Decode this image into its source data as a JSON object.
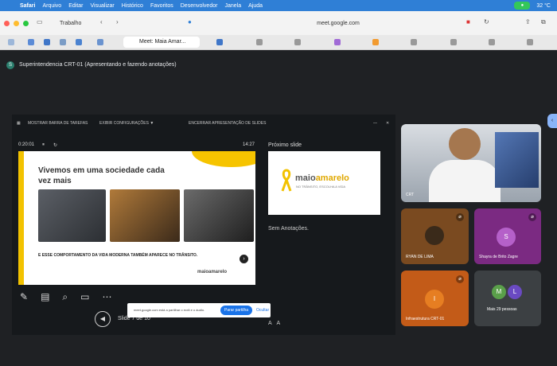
{
  "menubar": {
    "items": [
      "Safari",
      "Arquivo",
      "Editar",
      "Visualizar",
      "Histórico",
      "Favoritos",
      "Desenvolvedor",
      "Janela",
      "Ajuda"
    ],
    "weather": "32 °C"
  },
  "toolbar": {
    "profile": "Trabalho",
    "url": "meet.google.com",
    "active_tab": "Meet: Maia Amar..."
  },
  "meeting": {
    "title": "Superintendencia CRT-01 (Apresentando e fazendo anotações)"
  },
  "presenter": {
    "controls": [
      "MOSTRAR BARRA DE TAREFAS",
      "EXIBIR CONFIGURAÇÕES ▼",
      "ENCERRAR APRESENTAÇÃO DE SLIDES"
    ],
    "elapsed": "0:20:01",
    "clock": "14:27",
    "next_label": "Próximo slide",
    "notes": "Sem Anotações.",
    "slide_counter": "Slide 7 de 10",
    "zoom_labels": [
      "A",
      "A"
    ]
  },
  "slide": {
    "title": "Vivemos em uma sociedade cada vez mais",
    "caption": "E ESSE COMPORTAMENTO DA VIDA MODERNA TAMBÉM APARECE NO TRÂNSITO.",
    "logo": "maioamarelo"
  },
  "next_slide": {
    "logo_a": "maio",
    "logo_b": "amarelo",
    "sub": "NO TRÂNSITO, ESCOLHA A VIDA"
  },
  "share_banner": {
    "text": "meet.google.com está a partilhar o ecrã e o áudio.",
    "stop": "Parar partilha",
    "hide": "Ocultar"
  },
  "participants": {
    "main": "CRT",
    "tiles": [
      {
        "name": "RYAN DE LIMA",
        "initial": ""
      },
      {
        "name": "Shayra de Brito Zagre",
        "initial": "S"
      },
      {
        "name": "Infraestrutura CRT-01",
        "initial": "I"
      },
      {
        "name": "Mais 29 pessoas",
        "initial": "M"
      }
    ]
  }
}
